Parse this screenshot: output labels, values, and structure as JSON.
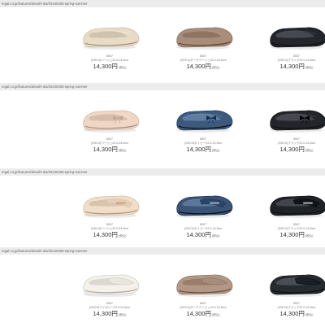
{
  "url_label": "regal.co.jp/features/detail/r-dot/20240306-spring-summer",
  "rows": [
    {
      "items": [
        {
          "code": "8507",
          "variant": "(GHC4)ベージュ22.0-24.5cm",
          "price": "14,300円",
          "tax": "(税込)",
          "color": "#e8dcc6",
          "icon": "ballet-flat-icon"
        },
        {
          "code": "8507",
          "variant": "(GHC4)ダークベージュ22.0-24.5cm",
          "price": "14,300円",
          "tax": "(税込)",
          "color": "#a88d7a",
          "icon": "ballet-flat-icon"
        },
        {
          "code": "8507",
          "variant": "(GHC4)ブラック22.0-24.5cm",
          "price": "14,300円",
          "tax": "(税込)",
          "color": "#23262c",
          "icon": "ballet-flat-icon"
        }
      ]
    },
    {
      "items": [
        {
          "code": "8507",
          "variant": "(GHC4)ベージュ22.0-24.5cm",
          "price": "14,300円",
          "tax": "(税込)",
          "color": "#f0d6c4",
          "icon": "bow-flat-icon"
        },
        {
          "code": "8507",
          "variant": "(GHC4)ネイビー22.0-24.5cm",
          "price": "14,300円",
          "tax": "(税込)",
          "color": "#3c5a7e",
          "icon": "bow-flat-icon"
        },
        {
          "code": "8507",
          "variant": "(GHC4)ブラック22.0-24.5cm",
          "price": "14,300円",
          "tax": "(税込)",
          "color": "#22252b",
          "icon": "bow-flat-icon"
        }
      ]
    },
    {
      "items": [
        {
          "code": "8507",
          "variant": "(GHC4)ベージュ22.0-24.5cm",
          "price": "14,300円",
          "tax": "(税込)",
          "color": "#f2ddc9",
          "icon": "bit-loafer-icon"
        },
        {
          "code": "8507",
          "variant": "(GHC4)ネイビー22.0-24.5cm",
          "price": "14,300円",
          "tax": "(税込)",
          "color": "#3a5478",
          "icon": "bit-loafer-icon"
        },
        {
          "code": "8507",
          "variant": "(GHC4)ブラック22.0-24.5cm",
          "price": "14,300円",
          "tax": "(税込)",
          "color": "#1f2228",
          "icon": "bit-loafer-icon"
        }
      ]
    },
    {
      "items": [
        {
          "code": "8507",
          "variant": "(GHC4)アイボリー22.0-24.5cm",
          "price": "14,300円",
          "tax": "(税込)",
          "color": "#f4f1ea",
          "icon": "slip-on-loafer-icon"
        },
        {
          "code": "8507",
          "variant": "(GHC4)ダークベージュ22.0-24.5cm",
          "price": "14,300円",
          "tax": "(税込)",
          "color": "#b29785",
          "icon": "slip-on-loafer-icon"
        },
        {
          "code": "8507",
          "variant": "(GHC4)ブラック22.0-24.5cm",
          "price": "14,300円",
          "tax": "(税込)",
          "color": "#262a31",
          "icon": "slip-on-loafer-icon"
        }
      ]
    }
  ]
}
